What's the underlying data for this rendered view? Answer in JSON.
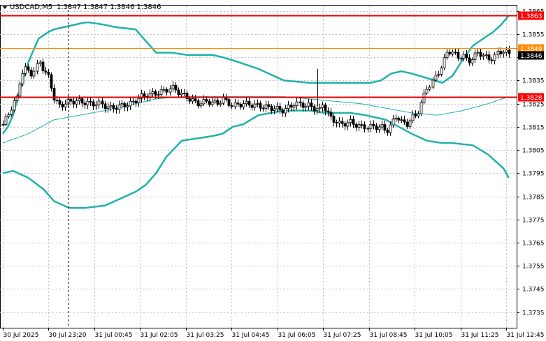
{
  "header": {
    "symbol": "USDCAD,M5",
    "ohlc": "1.3847 1.3847 1.3846 1.3846"
  },
  "chart_data": {
    "type": "candlestick",
    "ylim": [
      1.37283,
      1.38673
    ],
    "y_ticks": [
      "1.3865",
      "1.3855",
      "1.3845",
      "1.3835",
      "1.3825",
      "1.3815",
      "1.3805",
      "1.3795",
      "1.3785",
      "1.3775",
      "1.3765",
      "1.3755",
      "1.3745",
      "1.3735"
    ],
    "x_labels": [
      "30 Jul 2025",
      "30 Jul 23:20",
      "31 Jul 00:45",
      "31 Jul 02:05",
      "31 Jul 03:25",
      "31 Jul 04:45",
      "31 Jul 06:05",
      "31 Jul 07:25",
      "31 Jul 08:45",
      "31 Jul 10:05",
      "31 Jul 11:25",
      "31 Jul 12:45"
    ],
    "price_tags": [
      {
        "label": "1.3863",
        "value": 1.3863,
        "style": "red-line"
      },
      {
        "label": "1.3849",
        "value": 1.3849,
        "style": "orange-line"
      },
      {
        "label": "1.3846",
        "value": 1.3846,
        "style": "current"
      },
      {
        "label": "1.3828",
        "value": 1.3828,
        "style": "red-line"
      }
    ],
    "indicator": "Bollinger Bands",
    "colors": {
      "candle": "#000000",
      "bollinger": "#20b2aa",
      "support_resistance": "#e60000",
      "orange_line": "#ff8c00",
      "current_tag": "#000000",
      "red_tag": "#ff0000"
    },
    "series": [
      {
        "name": "upper",
        "x": [
          0,
          0.01,
          0.02,
          0.035,
          0.05,
          0.07,
          0.09,
          0.1,
          0.12,
          0.14,
          0.16,
          0.17,
          0.2,
          0.22,
          0.26,
          0.28,
          0.3,
          0.33,
          0.36,
          0.38,
          0.41,
          0.43,
          0.46,
          0.5,
          0.55,
          0.6,
          0.64,
          0.66,
          0.68,
          0.7,
          0.72,
          0.74,
          0.76,
          0.78,
          0.8,
          0.815,
          0.83,
          0.86,
          0.88,
          0.9,
          0.92,
          0.94,
          0.96,
          0.975,
          0.99
        ],
        "y": [
          1.3812,
          1.3815,
          1.382,
          1.3832,
          1.3843,
          1.3853,
          1.3856,
          1.3857,
          1.3858,
          1.3859,
          1.386,
          1.386,
          1.3859,
          1.3858,
          1.3857,
          1.3852,
          1.3847,
          1.3847,
          1.3846,
          1.3846,
          1.3846,
          1.3845,
          1.3843,
          1.384,
          1.3835,
          1.3834,
          1.3834,
          1.3834,
          1.3834,
          1.3834,
          1.3834,
          1.3835,
          1.3838,
          1.3839,
          1.3838,
          1.3837,
          1.3836,
          1.3834,
          1.3837,
          1.3844,
          1.385,
          1.3853,
          1.3856,
          1.3859,
          1.3863
        ]
      },
      {
        "name": "middle",
        "x": [
          0,
          0.05,
          0.1,
          0.15,
          0.2,
          0.26,
          0.3,
          0.35,
          0.4,
          0.45,
          0.5,
          0.55,
          0.6,
          0.65,
          0.7,
          0.75,
          0.8,
          0.85,
          0.9,
          0.95,
          0.99
        ],
        "y": [
          1.3808,
          1.3812,
          1.3818,
          1.382,
          1.3822,
          1.3825,
          1.3827,
          1.3828,
          1.3828,
          1.3828,
          1.3828,
          1.3828,
          1.3827,
          1.3826,
          1.3825,
          1.3823,
          1.3821,
          1.382,
          1.3822,
          1.3825,
          1.3828
        ]
      },
      {
        "name": "lower",
        "x": [
          0,
          0.02,
          0.05,
          0.08,
          0.1,
          0.13,
          0.16,
          0.2,
          0.23,
          0.26,
          0.28,
          0.3,
          0.32,
          0.35,
          0.38,
          0.41,
          0.43,
          0.45,
          0.47,
          0.5,
          0.55,
          0.6,
          0.63,
          0.65,
          0.68,
          0.71,
          0.73,
          0.75,
          0.8,
          0.83,
          0.86,
          0.88,
          0.92,
          0.95,
          0.98,
          0.99
        ],
        "y": [
          1.3795,
          1.3796,
          1.3793,
          1.3788,
          1.3783,
          1.378,
          1.378,
          1.3781,
          1.3784,
          1.3787,
          1.379,
          1.3795,
          1.3802,
          1.3809,
          1.381,
          1.3811,
          1.3812,
          1.3815,
          1.3816,
          1.382,
          1.3822,
          1.3822,
          1.3821,
          1.3821,
          1.3821,
          1.382,
          1.3819,
          1.3818,
          1.3812,
          1.3809,
          1.3808,
          1.3808,
          1.3807,
          1.3803,
          1.3797,
          1.3793
        ]
      },
      {
        "name": "price",
        "x": [
          0,
          0.01,
          0.02,
          0.03,
          0.035,
          0.045,
          0.055,
          0.065,
          0.07,
          0.08,
          0.09,
          0.1,
          0.11,
          0.13,
          0.15,
          0.17,
          0.19,
          0.21,
          0.23,
          0.25,
          0.27,
          0.29,
          0.31,
          0.33,
          0.35,
          0.38,
          0.4,
          0.42,
          0.43,
          0.45,
          0.47,
          0.5,
          0.53,
          0.55,
          0.57,
          0.6,
          0.62,
          0.625,
          0.64,
          0.66,
          0.68,
          0.7,
          0.72,
          0.74,
          0.75,
          0.76,
          0.77,
          0.78,
          0.79,
          0.8,
          0.81,
          0.82,
          0.83,
          0.84,
          0.85,
          0.86,
          0.87,
          0.88,
          0.89,
          0.9,
          0.91,
          0.92,
          0.93,
          0.94,
          0.95,
          0.96,
          0.97,
          0.98,
          0.99
        ],
        "y": [
          1.3816,
          1.382,
          1.3825,
          1.3828,
          1.3838,
          1.384,
          1.3838,
          1.384,
          1.3844,
          1.3839,
          1.3836,
          1.3827,
          1.3824,
          1.3826,
          1.3826,
          1.3825,
          1.3825,
          1.3823,
          1.3824,
          1.3825,
          1.3828,
          1.3829,
          1.383,
          1.3832,
          1.3829,
          1.3825,
          1.3826,
          1.3825,
          1.3827,
          1.3824,
          1.3825,
          1.3824,
          1.3823,
          1.3822,
          1.3825,
          1.3824,
          1.3822,
          1.3825,
          1.3819,
          1.3816,
          1.3817,
          1.3815,
          1.3815,
          1.3815,
          1.3813,
          1.3816,
          1.382,
          1.3817,
          1.3816,
          1.3819,
          1.382,
          1.3826,
          1.3832,
          1.3834,
          1.3838,
          1.3842,
          1.3848,
          1.3847,
          1.3845,
          1.3846,
          1.3843,
          1.3845,
          1.3847,
          1.3846,
          1.3844,
          1.3845,
          1.3847,
          1.3848,
          1.3846
        ]
      }
    ]
  }
}
